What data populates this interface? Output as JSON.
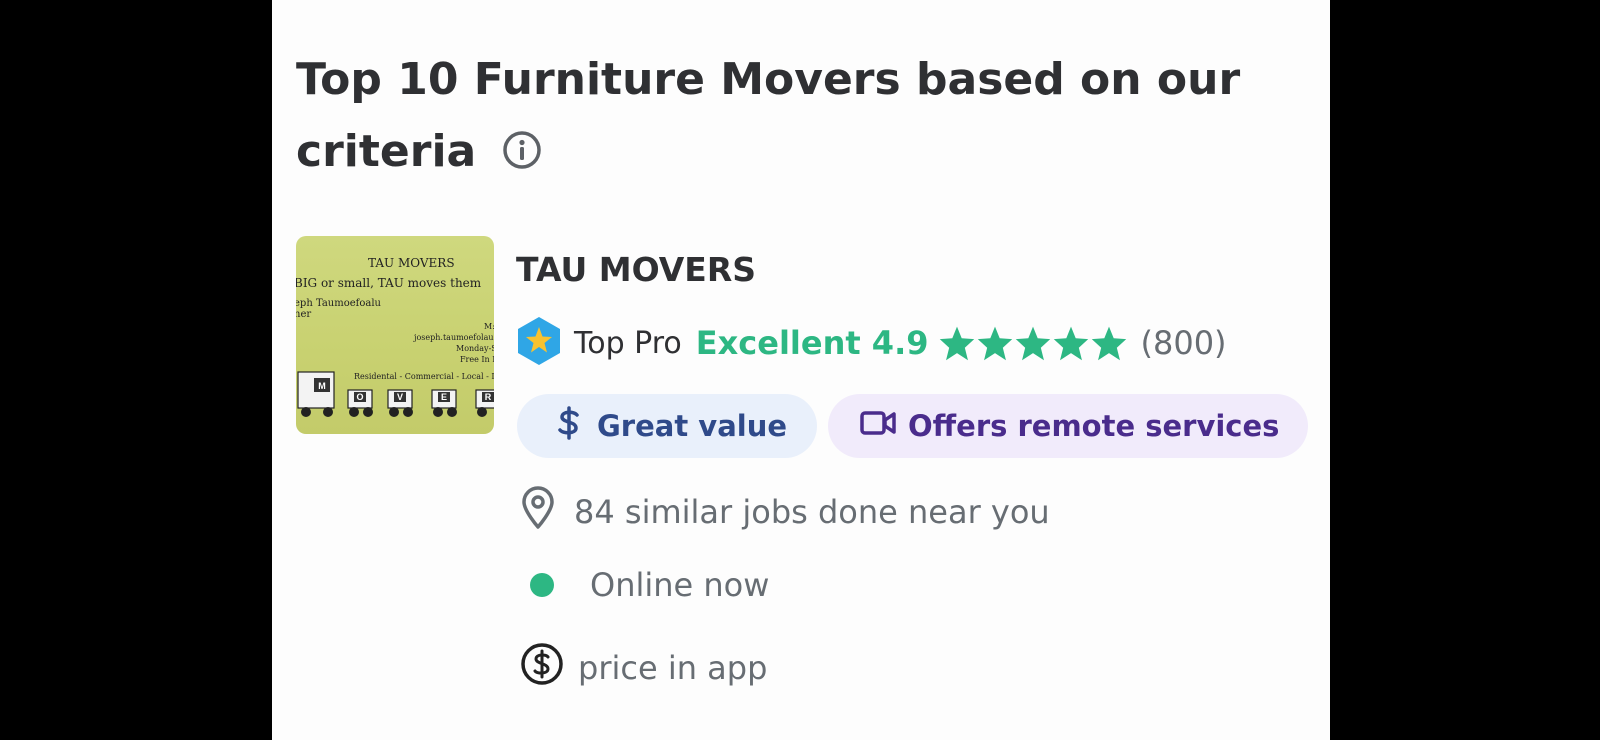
{
  "headline": {
    "line1": "Top 10 Furniture Movers based on our",
    "line2": "criteria"
  },
  "pro": {
    "name": "TAU MOVERS",
    "badge": "Top Pro",
    "rating_word": "Excellent 4.9",
    "rating": 4.9,
    "stars_filled": 5,
    "review_count": "(800)"
  },
  "badges": {
    "value": "Great value",
    "remote": "Offers remote services"
  },
  "facts": {
    "jobs": "84 similar jobs done near you",
    "online": "Online now",
    "price": "price in app"
  },
  "image_text": {
    "company": "TAU MOVERS",
    "slogan": "BIG or small, TAU moves them",
    "owner_name": "eph Taumoefoalu",
    "owner_title": "ner",
    "m": "M:",
    "email": "joseph.taumoefolau",
    "hours": "Monday-S",
    "free": "Free In H",
    "services": "Residental - Commercial - Local - L",
    "truck_letters": [
      "M",
      "O",
      "V",
      "E",
      "R"
    ]
  },
  "colors": {
    "accent_green": "#2db783",
    "value_badge_bg": "#e9f0fb",
    "remote_badge_bg": "#f1ebfb",
    "top_pro_blue": "#2fa6e6"
  },
  "icons": {
    "info": "info-circle-icon",
    "top_pro": "hexagon-star-icon",
    "value": "dollar-icon",
    "remote": "video-camera-icon",
    "location": "location-pin-icon",
    "online": "online-dot-icon",
    "price": "dollar-circle-icon"
  }
}
